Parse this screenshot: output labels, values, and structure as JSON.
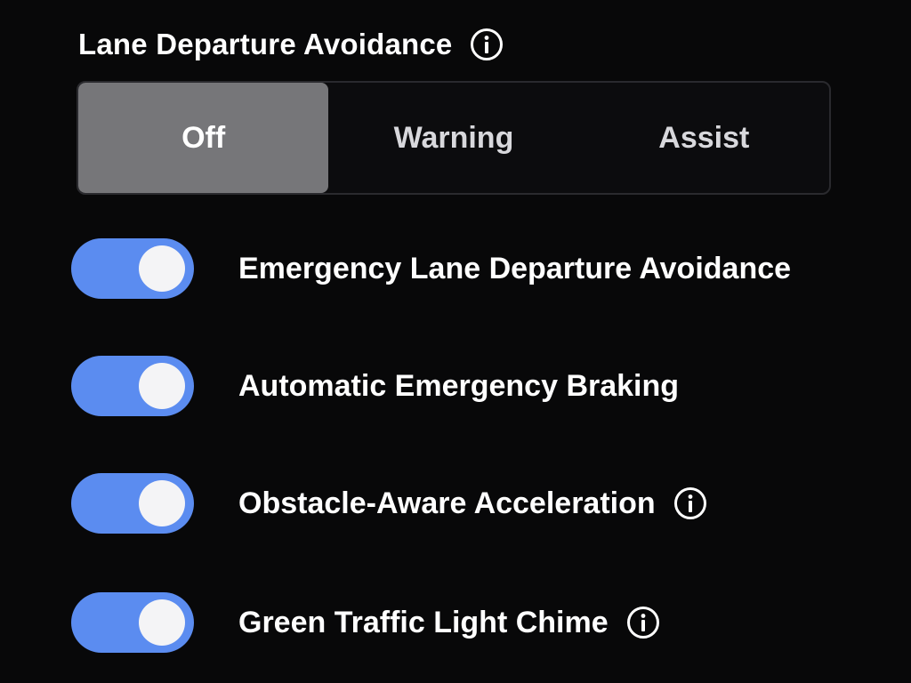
{
  "lane_departure": {
    "title": "Lane Departure Avoidance",
    "info_icon": "info-icon",
    "options": [
      "Off",
      "Warning",
      "Assist"
    ],
    "selected": "Off"
  },
  "toggles": [
    {
      "label": "Emergency Lane Departure Avoidance",
      "on": true,
      "has_info": false
    },
    {
      "label": "Automatic Emergency Braking",
      "on": true,
      "has_info": false
    },
    {
      "label": "Obstacle-Aware Acceleration",
      "on": true,
      "has_info": true
    },
    {
      "label": "Green Traffic Light Chime",
      "on": true,
      "has_info": true
    }
  ],
  "colors": {
    "background": "#080809",
    "toggle_on": "#5b8cf0",
    "segment_selected": "#767679",
    "text": "#ffffff"
  }
}
